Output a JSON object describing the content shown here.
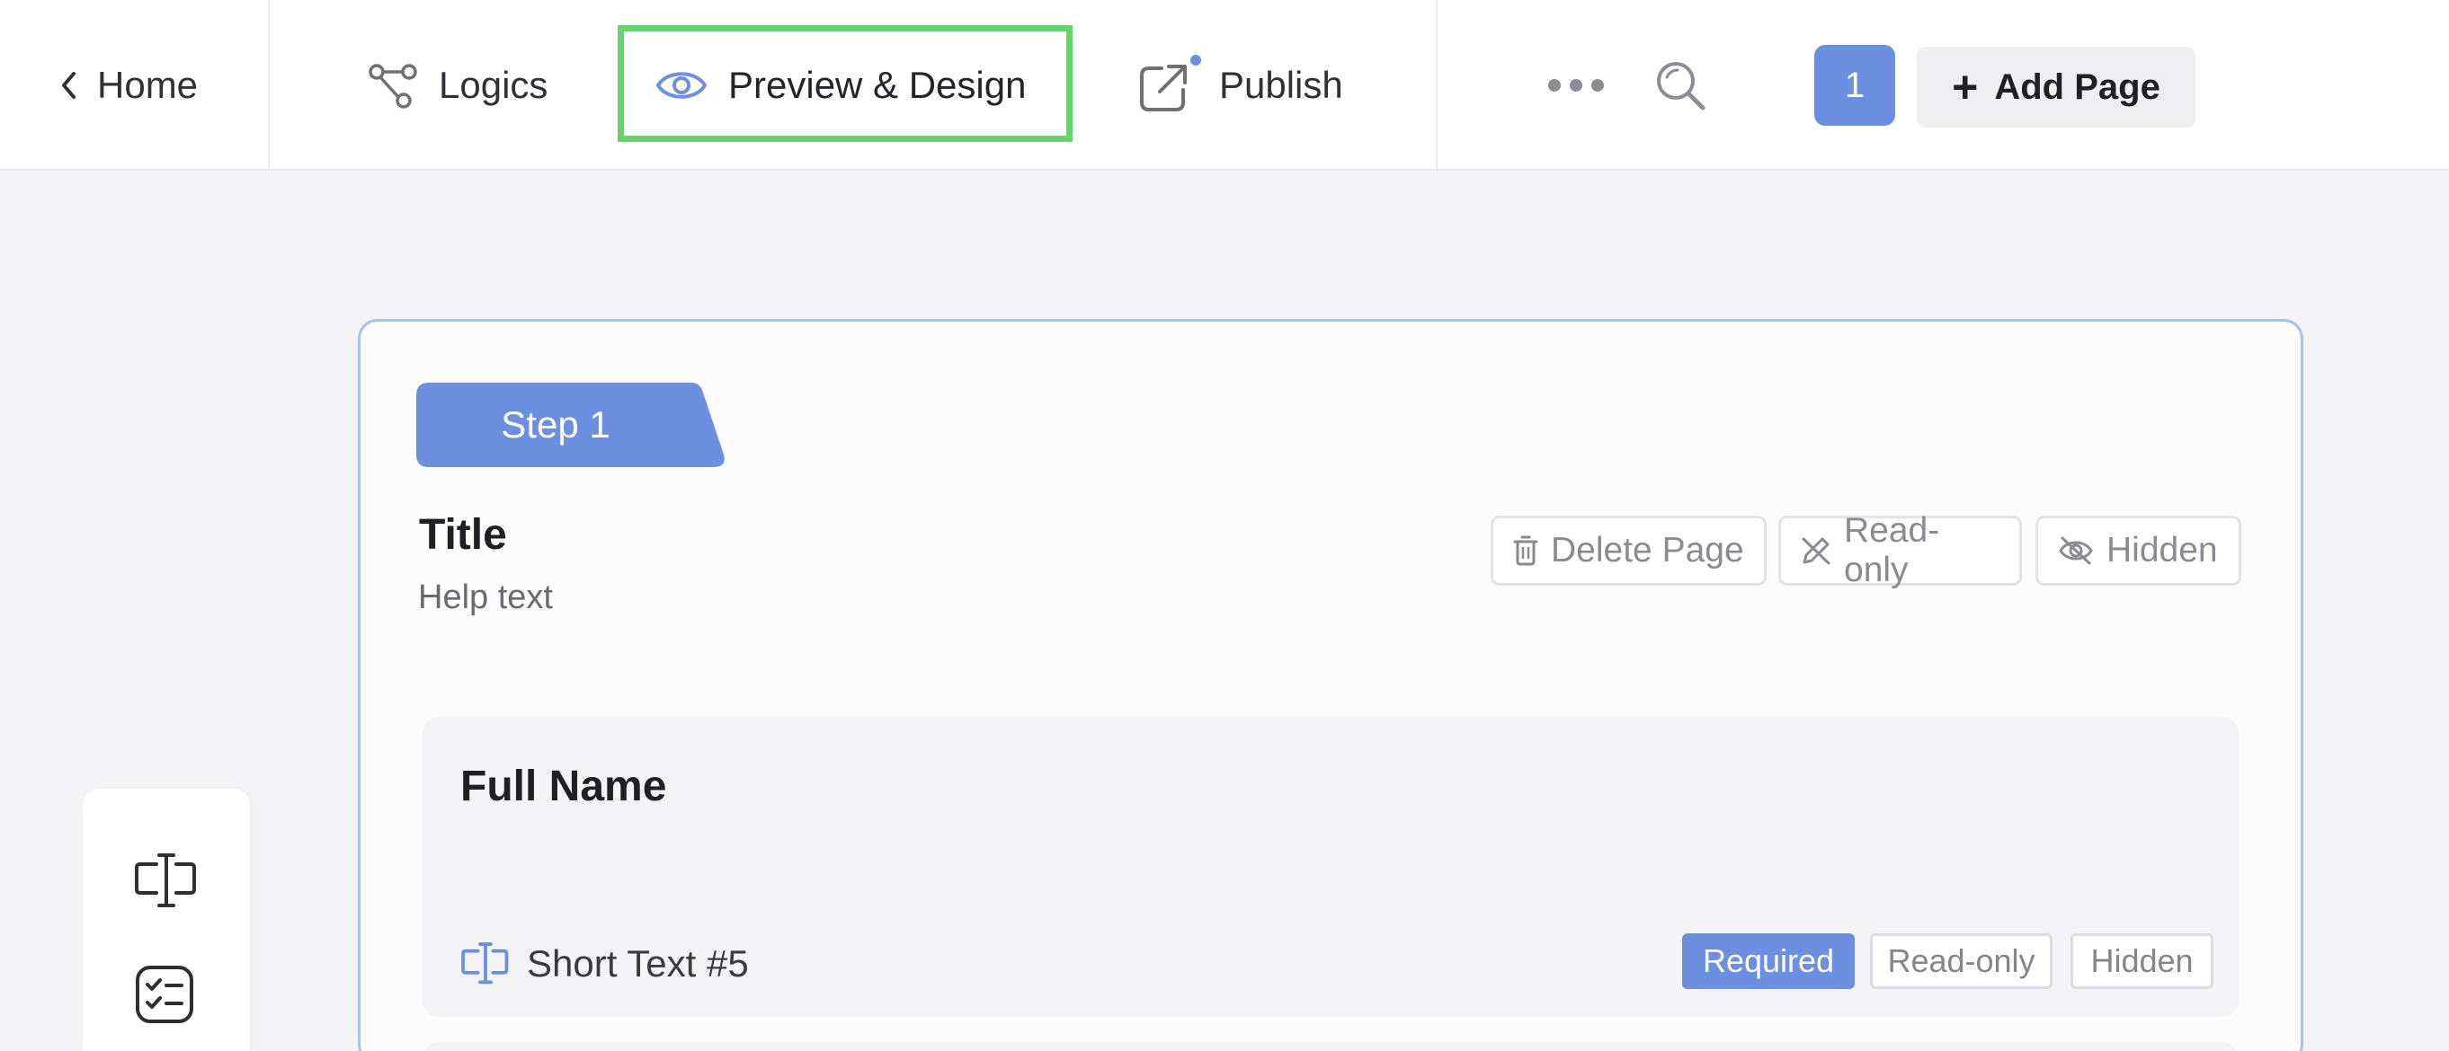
{
  "header": {
    "home_label": "Home",
    "tabs": [
      {
        "label": "Logics",
        "icon": "share-nodes-icon"
      },
      {
        "label": "Preview & Design",
        "icon": "eye-icon",
        "active": true
      },
      {
        "label": "Publish",
        "icon": "external-link-icon",
        "has_dot": true
      }
    ],
    "page_number": "1",
    "add_page_label": "Add Page"
  },
  "toolbar": {
    "icons": [
      "short-text-field-icon",
      "checklist-icon"
    ]
  },
  "page": {
    "step_label": "Step 1",
    "title": "Title",
    "help_text": "Help text",
    "actions": {
      "delete": "Delete Page",
      "readonly": "Read-only",
      "hidden": "Hidden"
    }
  },
  "field": {
    "title": "Full Name",
    "type_label": "Short Text #5",
    "tags": {
      "required": "Required",
      "readonly": "Read-only",
      "hidden": "Hidden"
    }
  },
  "colors": {
    "accent": "#6d8fe0",
    "highlight_border": "#69d26c",
    "card_border": "#a9c1ef"
  }
}
